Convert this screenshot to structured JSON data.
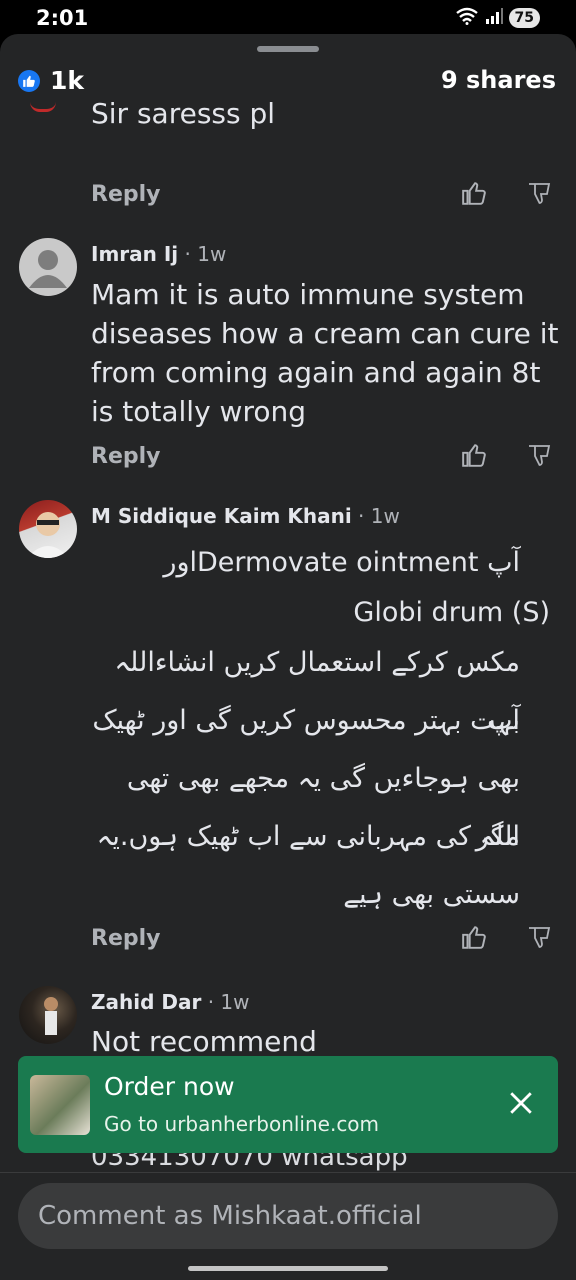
{
  "status": {
    "time": "2:01",
    "battery": "75"
  },
  "header": {
    "reactions_count": "1k",
    "shares": "9 shares"
  },
  "labels": {
    "reply": "Reply"
  },
  "comments": [
    {
      "text": "Sir saresss pl"
    },
    {
      "name": "Imran Ij",
      "time": "· 1w",
      "text": "Mam it is auto immune system diseases how a cream can cure it from coming again and again 8t is totally wrong"
    },
    {
      "name": "M Siddique Kaim Khani",
      "time": "· 1w",
      "lines": [
        "آپ Dermovate ointmentاور",
        "Globi drum (S)",
        "مکس کرکے استعمال کریں انشاءاللہ آپ",
        "بہت بہتر محسوس کریں گی اور ٹھیک",
        "بھی ہوجاءیں گی یہ مجھے بھی تھی مگر",
        "اللہ کی مہربانی سے اب ٹھیک ہوں.یہ",
        "سستی بھی ہیے"
      ]
    },
    {
      "name": "Zahid Dar",
      "time": "· 1w",
      "text": "Not recommend"
    }
  ],
  "behind_ad_text": "03341307070 whatsapp",
  "ad": {
    "title": "Order now",
    "url": "Go to urbanherbonline.com"
  },
  "composer": {
    "placeholder": "Comment as Mishkaat.official"
  },
  "colors": {
    "accent": "#1877f2",
    "ad_bg": "#1a7a4f",
    "sheet_bg": "#242526"
  },
  "icons": [
    "like-icon",
    "thumbs-up-icon",
    "thumbs-down-icon",
    "close-icon",
    "wifi-icon",
    "signal-icon"
  ]
}
